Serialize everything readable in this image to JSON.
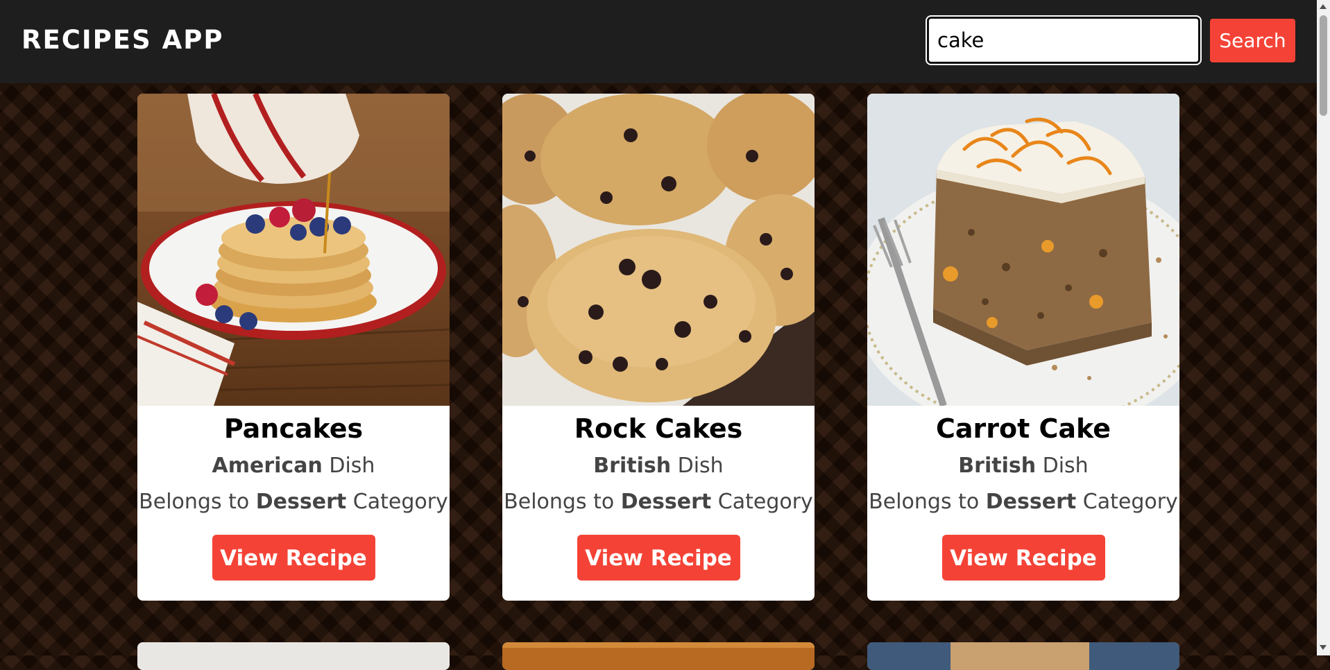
{
  "header": {
    "brand": "RECIPES APP",
    "search_value": "cake",
    "search_button": "Search"
  },
  "cards": [
    {
      "title": "Pancakes",
      "area": "American",
      "dish_suffix": " Dish",
      "category_prefix": "Belongs to ",
      "category": "Dessert",
      "category_suffix": " Category",
      "button": "View Recipe",
      "image": "pancakes-photo"
    },
    {
      "title": "Rock Cakes",
      "area": "British",
      "dish_suffix": " Dish",
      "category_prefix": "Belongs to ",
      "category": "Dessert",
      "category_suffix": " Category",
      "button": "View Recipe",
      "image": "rock-cakes-photo"
    },
    {
      "title": "Carrot Cake",
      "area": "British",
      "dish_suffix": " Dish",
      "category_prefix": "Belongs to ",
      "category": "Dessert",
      "category_suffix": " Category",
      "button": "View Recipe",
      "image": "carrot-cake-photo"
    }
  ],
  "colors": {
    "header_bg": "#1e1e1e",
    "accent": "#f44336",
    "page_bg": "#2a1408"
  }
}
